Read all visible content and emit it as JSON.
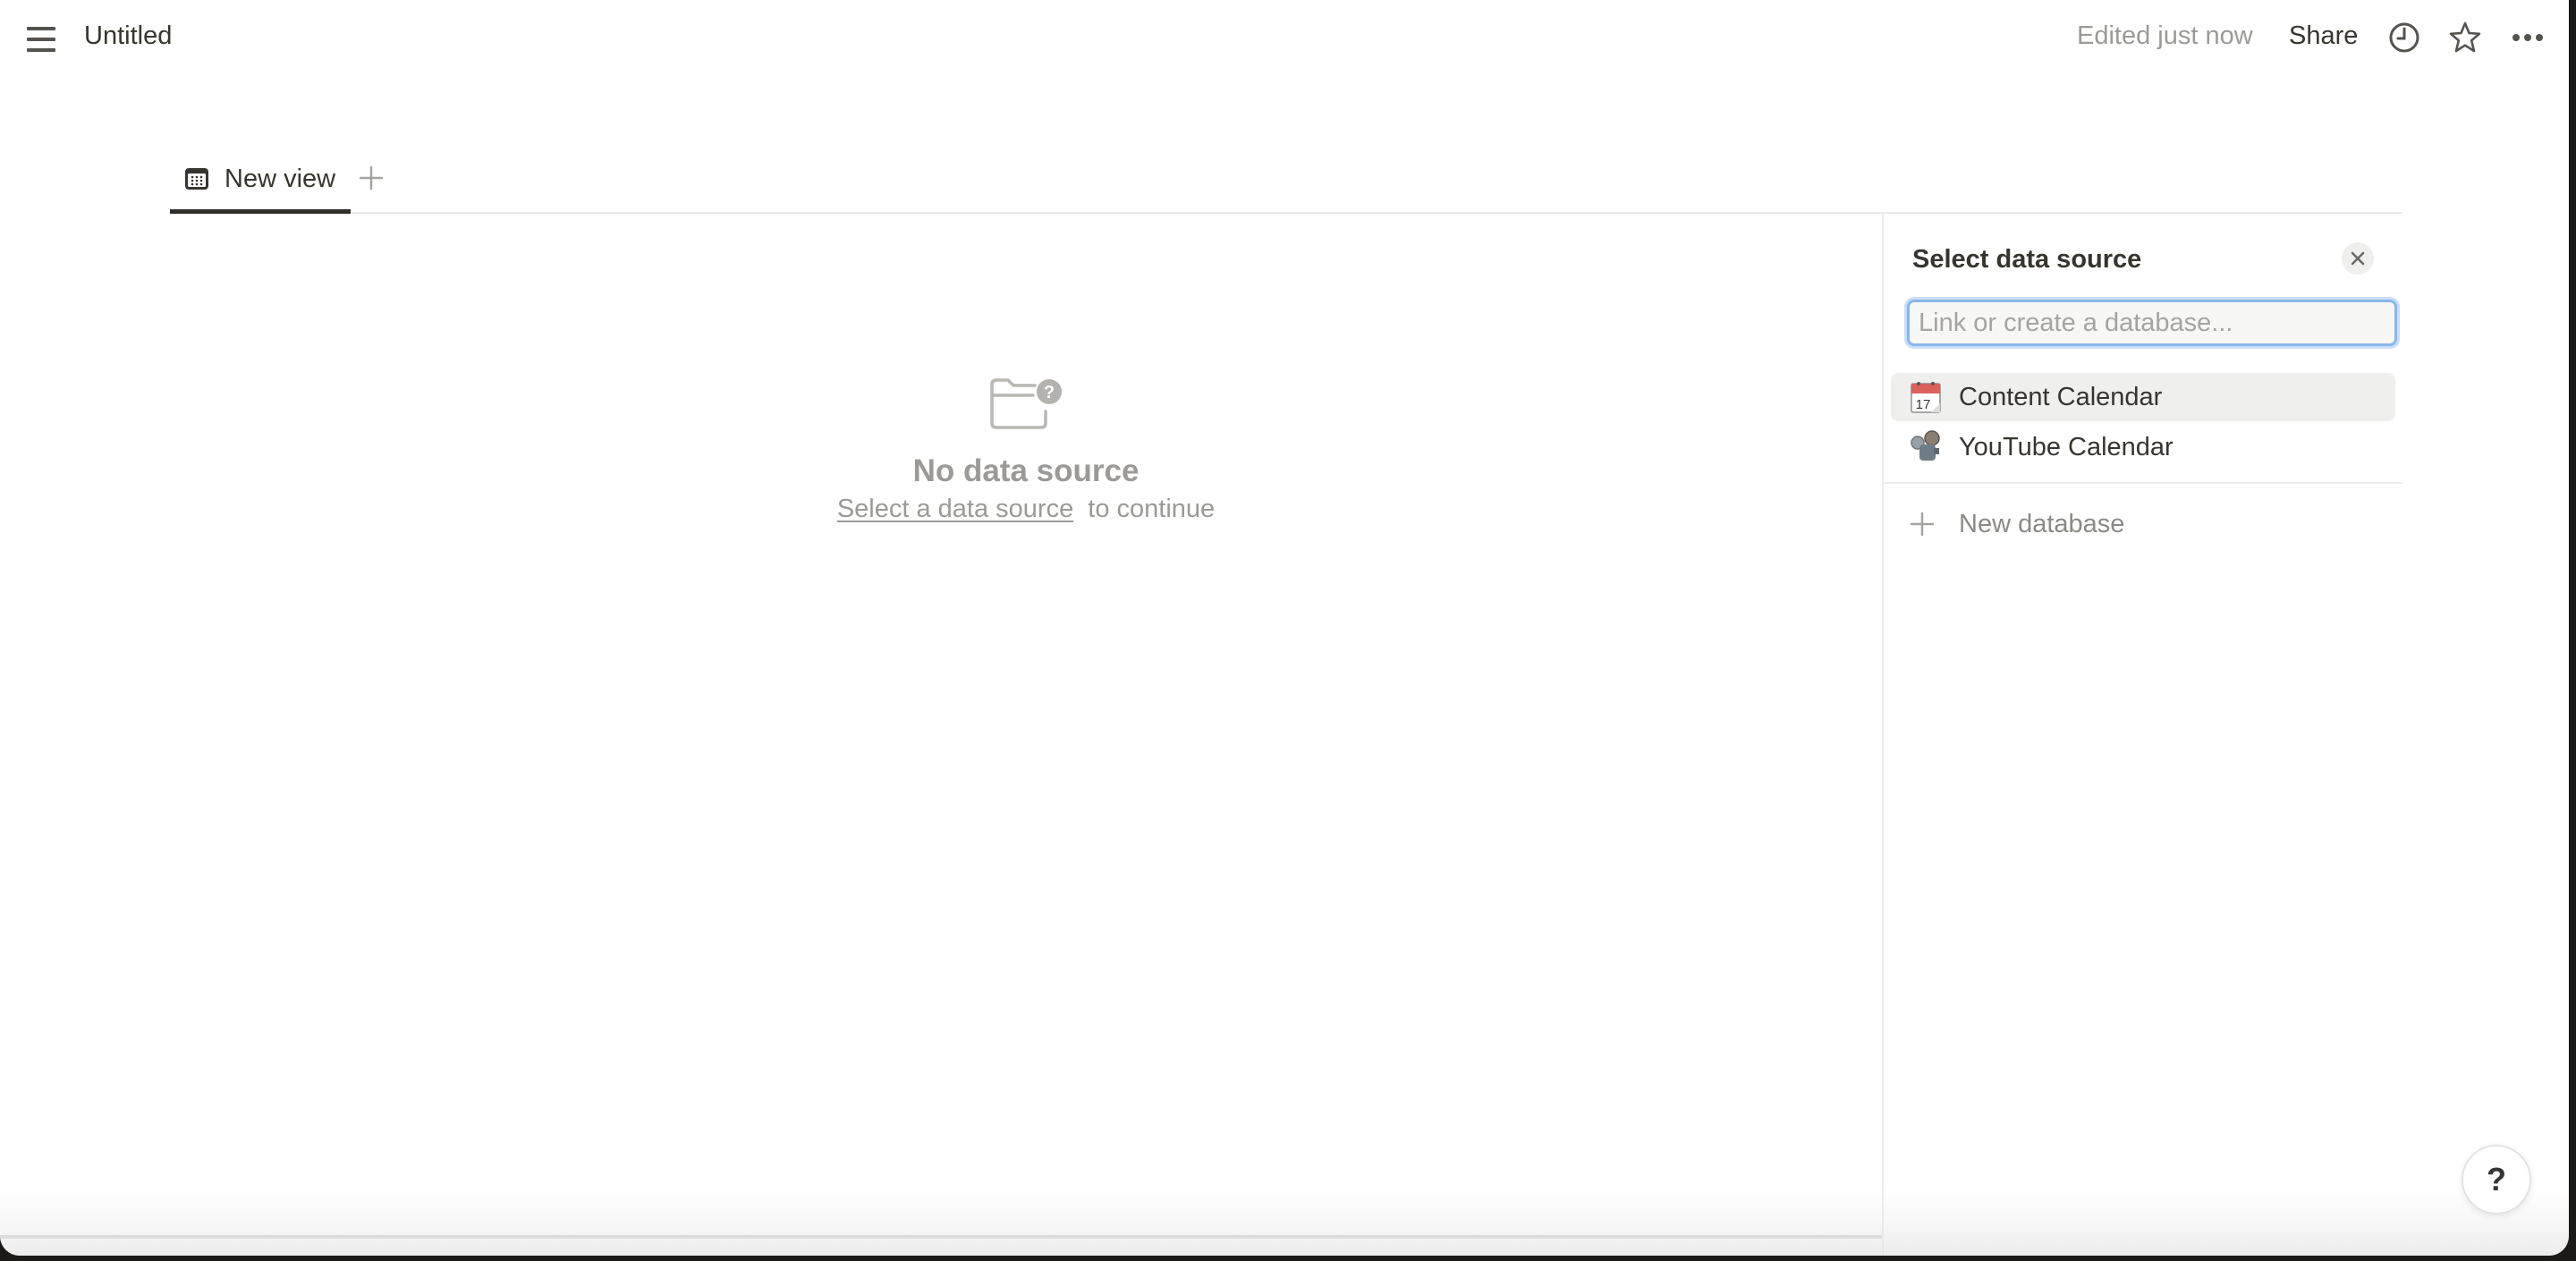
{
  "header": {
    "title": "Untitled",
    "edited_status": "Edited just now",
    "share_label": "Share",
    "icons": [
      "menu-icon",
      "clock-icon",
      "star-icon",
      "more-icon"
    ]
  },
  "tabs": [
    {
      "label": "New view",
      "icon": "calendar-icon",
      "active": true
    }
  ],
  "empty_state": {
    "icon": "folder-question-icon",
    "title": "No data source",
    "link_text": "Select a data source",
    "suffix_text": "to continue"
  },
  "panel": {
    "title": "Select data source",
    "search": {
      "placeholder": "Link or create a database...",
      "value": ""
    },
    "items": [
      {
        "label": "Content Calendar",
        "icon": "calendar-emoji",
        "hovered": true
      },
      {
        "label": "YouTube Calendar",
        "icon": "film-projector-emoji",
        "hovered": false
      }
    ],
    "new_database_label": "New database"
  },
  "help_label": "?",
  "colors": {
    "text": "#37352f",
    "muted": "#9b9a97",
    "focus_ring": "#8ab6ea",
    "hover_bg": "#efefee"
  }
}
